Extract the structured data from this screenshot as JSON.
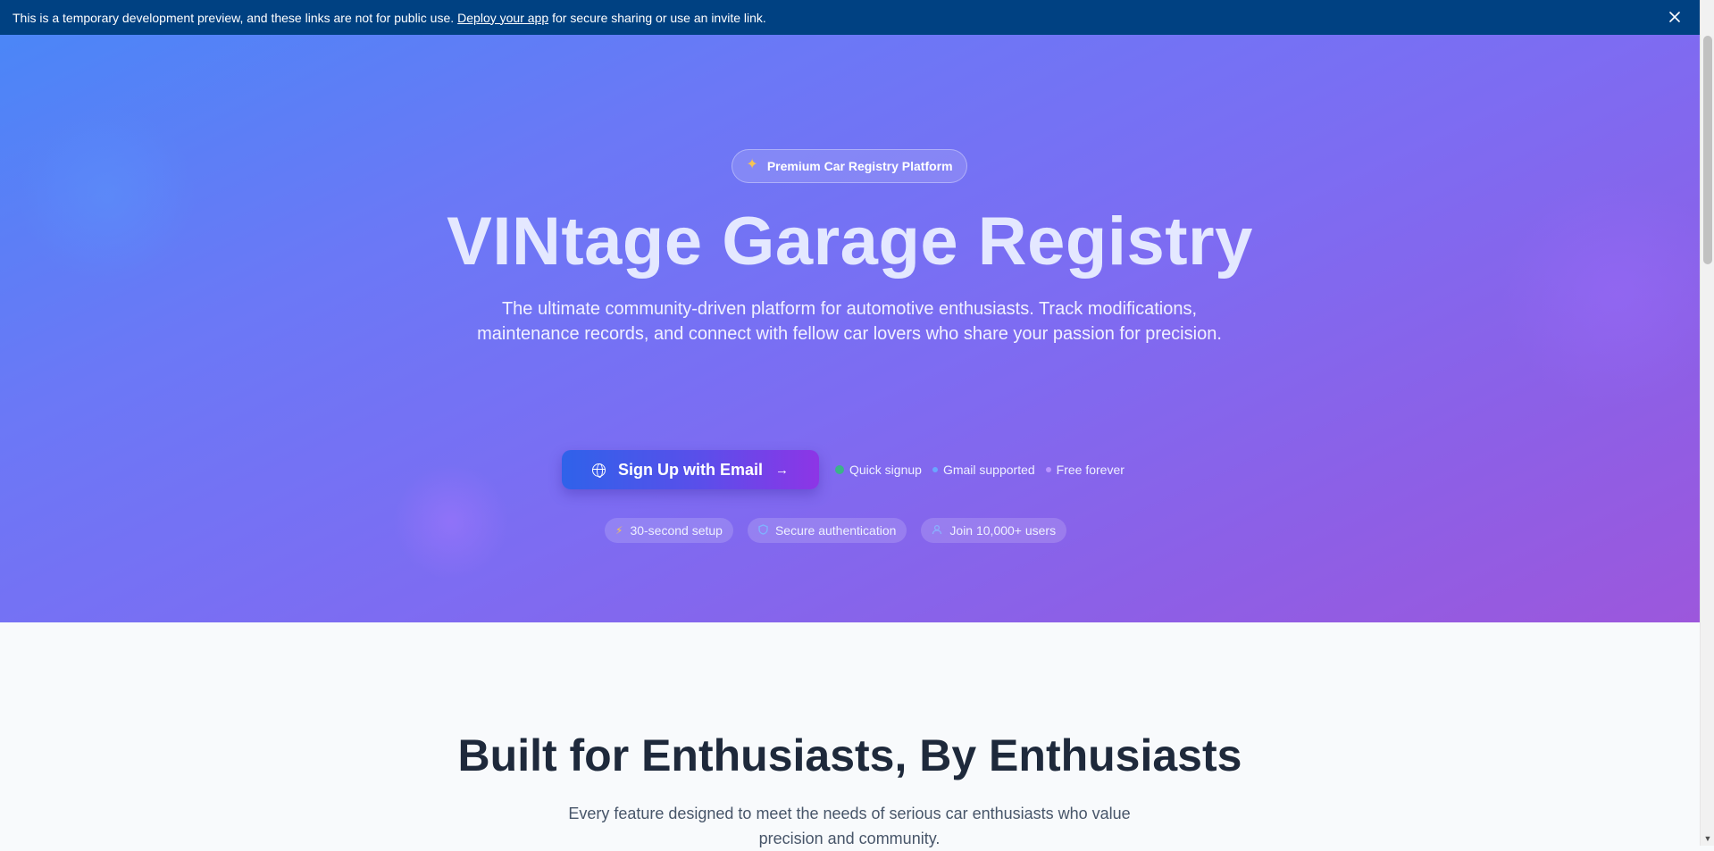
{
  "banner": {
    "text_before": "This is a temporary development preview, and these links are not for public use.",
    "link_label": "Deploy your app",
    "text_after": "for secure sharing or use an invite link.",
    "close_icon": "close-icon"
  },
  "hero": {
    "badge_icon": "sparkles-icon",
    "badge_label": "Premium Car Registry Platform",
    "title": "VINtage Garage Registry",
    "subtitle": "The ultimate community-driven platform for automotive enthusiasts. Track modifications, maintenance records, and connect with fellow car lovers who share your passion for precision.",
    "cta": {
      "icon": "globe-icon",
      "label": "Sign Up with Email",
      "arrow_icon": "arrow-right-icon"
    },
    "checks": [
      {
        "label": "Quick signup",
        "color": "#3bb28a"
      },
      {
        "label": "Gmail supported",
        "color": "#6aa6ff"
      },
      {
        "label": "Free forever",
        "color": "#b994ff"
      }
    ],
    "chips": [
      {
        "icon": "lightning-icon",
        "label": "30-second setup"
      },
      {
        "icon": "shield-icon",
        "label": "Secure authentication"
      },
      {
        "icon": "users-icon",
        "label": "Join 10,000+ users"
      }
    ]
  },
  "features": {
    "title": "Built for Enthusiasts, By Enthusiasts",
    "subtitle": "Every feature designed to meet the needs of serious car enthusiasts who value precision and community."
  },
  "colors": {
    "banner_bg": "#004182",
    "hero_gradient_start": "#4b86f7",
    "hero_gradient_end": "#9c57dc",
    "cta_start": "#2f62ea",
    "cta_end": "#8d35e6",
    "heading_dark": "#1e293b"
  }
}
